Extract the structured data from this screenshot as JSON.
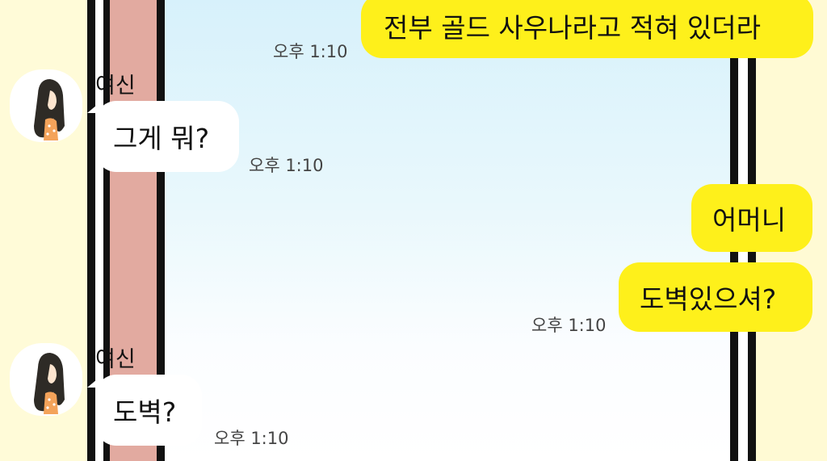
{
  "messages": [
    {
      "sender": "me",
      "text": "전부 골드 사우나라고 적혀 있더라",
      "time": "오후 1:10"
    },
    {
      "sender": "them",
      "name": "여신",
      "text": "그게 뭐?",
      "time": "오후 1:10"
    },
    {
      "sender": "me",
      "text": "어머니",
      "time": ""
    },
    {
      "sender": "me",
      "text": "도벽있으셔?",
      "time": "오후 1:10"
    },
    {
      "sender": "them",
      "name": "여신",
      "text": "도벽?",
      "time": "오후 1:10"
    }
  ],
  "colors": {
    "my_bubble": "#fef01b",
    "their_bubble": "#ffffff",
    "window_sky": "#d7f1fb",
    "curtain": "#e2aaa0",
    "wallpaper": "#fffbd8"
  },
  "icons": {
    "avatar": "girl-long-hair-avatar-icon"
  }
}
